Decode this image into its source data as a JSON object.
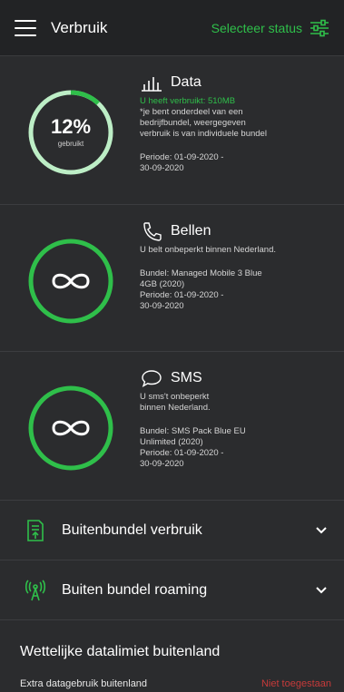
{
  "header": {
    "title": "Verbruik",
    "status_link": "Selecteer status"
  },
  "data_card": {
    "percent": "12%",
    "percent_sub": "gebruikt",
    "usage_fraction": 0.12,
    "title": "Data",
    "used_line": "U heeft verbruikt: 510MB",
    "note_lines": [
      "*je bent onderdeel van een",
      "bedrijfbundel, weergegeven",
      "verbruik is van individuele bundel"
    ],
    "period_lines": [
      "Periode: 01-09-2020 -",
      "30-09-2020"
    ]
  },
  "calls_card": {
    "title": "Bellen",
    "desc": "U belt onbeperkt binnen Nederland.",
    "bundle_lines": [
      "Bundel: Managed Mobile 3 Blue",
      "4GB (2020)"
    ],
    "period_lines": [
      "Periode: 01-09-2020 -",
      "30-09-2020"
    ]
  },
  "sms_card": {
    "title": "SMS",
    "desc_lines": [
      "U sms't onbeperkt",
      "binnen Nederland."
    ],
    "bundle_lines": [
      "Bundel: SMS Pack Blue EU",
      "Unlimited (2020)"
    ],
    "period_lines": [
      "Periode: 01-09-2020 -",
      "30-09-2020"
    ]
  },
  "accordions": [
    {
      "label": "Buitenbundel verbruik"
    },
    {
      "label": "Buiten bundel roaming"
    }
  ],
  "legal": {
    "title": "Wettelijke datalimiet buitenland",
    "row_label": "Extra datagebruik buitenland",
    "row_value": "Niet toegestaan"
  },
  "colors": {
    "accent_green": "#2fbf4a",
    "ring_light": "#bdeec6",
    "background": "#2b2c2e",
    "danger": "#c63a3a"
  },
  "icons": {
    "menu": "hamburger-icon",
    "filter": "sliders-icon",
    "data": "bar-chart-icon",
    "calls": "phone-icon",
    "sms": "chat-bubble-icon",
    "infinity": "infinity-icon",
    "outside_bundle": "document-arrow-icon",
    "roaming": "antenna-icon",
    "expand": "chevron-down-icon"
  }
}
